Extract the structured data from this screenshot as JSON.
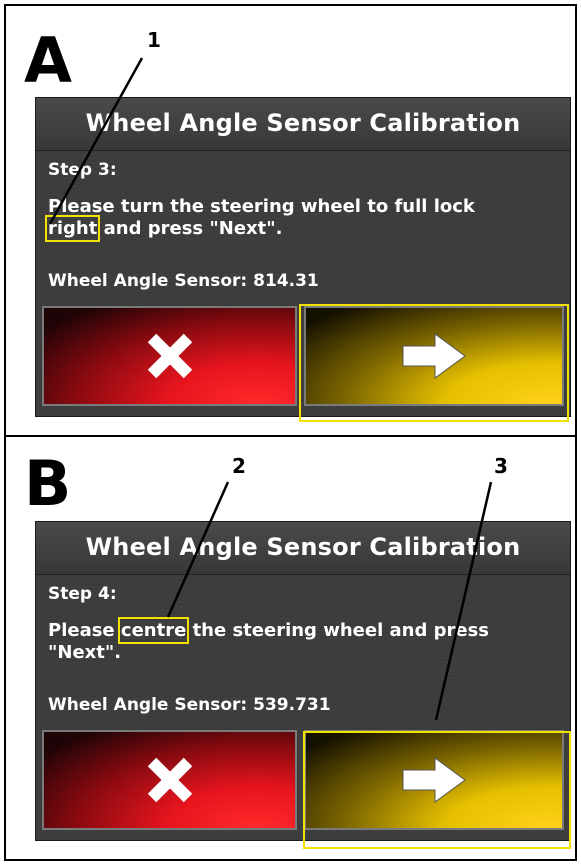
{
  "panels": [
    {
      "letter": "A",
      "callouts": [
        "1"
      ],
      "screen": {
        "title": "Wheel Angle Sensor Calibration",
        "step": "Step 3:",
        "instruction_pre": "Please turn the steering wheel to full lock ",
        "instruction_highlight": "right",
        "instruction_post": " and press \"Next\".",
        "sensor_label": "Wheel Angle Sensor: 814.31",
        "cancel_icon": "close-icon",
        "next_icon": "arrow-right-icon"
      }
    },
    {
      "letter": "B",
      "callouts": [
        "2",
        "3"
      ],
      "screen": {
        "title": "Wheel Angle Sensor Calibration",
        "step": "Step 4:",
        "instruction_pre": "Please ",
        "instruction_highlight": "centre",
        "instruction_post": " the steering wheel and press \"Next\".",
        "sensor_label": "Wheel Angle Sensor: 539.731",
        "cancel_icon": "close-icon",
        "next_icon": "arrow-right-icon"
      }
    }
  ],
  "colors": {
    "highlight": "#f2e200",
    "cancel": "#e6141e",
    "next": "#e6c000",
    "screen_bg": "#3c3c3c"
  }
}
